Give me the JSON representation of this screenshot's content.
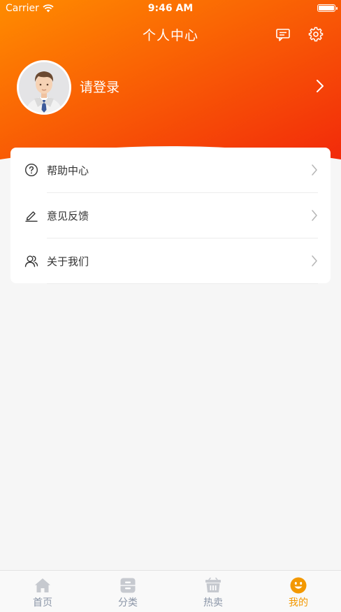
{
  "status_bar": {
    "carrier": "Carrier",
    "time": "9:46 AM"
  },
  "header": {
    "title": "个人中心",
    "icons": [
      "message-icon",
      "settings-gear-icon"
    ]
  },
  "profile": {
    "login_label": "请登录"
  },
  "menu": [
    {
      "label": "帮助中心",
      "icon": "help-circle-icon"
    },
    {
      "label": "意见反馈",
      "icon": "edit-pencil-icon"
    },
    {
      "label": "关于我们",
      "icon": "users-icon"
    }
  ],
  "tabs": [
    {
      "label": "首页",
      "icon": "home-icon",
      "active": false
    },
    {
      "label": "分类",
      "icon": "category-icon",
      "active": false
    },
    {
      "label": "热卖",
      "icon": "basket-icon",
      "active": false
    },
    {
      "label": "我的",
      "icon": "smiley-icon",
      "active": true
    }
  ],
  "colors": {
    "header_start": "#ff8a00",
    "header_end": "#f2300b",
    "active_tab": "#f39800",
    "inactive_tab": "#8a95a7"
  }
}
